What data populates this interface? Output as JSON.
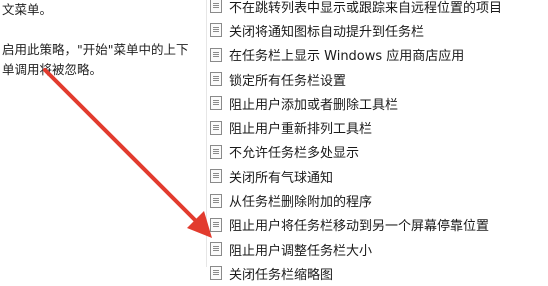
{
  "left_pane": {
    "line1": "文菜单。",
    "line2": "启用此策略，\"开始\"菜单中的上下",
    "line3": "单调用将被忽略。"
  },
  "policy_list": [
    {
      "label": "不在跳转列表中显示或跟踪来自远程位置的项目"
    },
    {
      "label": "关闭将通知图标自动提升到任务栏"
    },
    {
      "label": "在任务栏上显示 Windows 应用商店应用"
    },
    {
      "label": "锁定所有任务栏设置"
    },
    {
      "label": "阻止用户添加或者删除工具栏"
    },
    {
      "label": "阻止用户重新排列工具栏"
    },
    {
      "label": "不允许任务栏多处显示"
    },
    {
      "label": "关闭所有气球通知"
    },
    {
      "label": "从任务栏删除附加的程序"
    },
    {
      "label": "阻止用户将任务栏移动到另一个屏幕停靠位置"
    },
    {
      "label": "阻止用户调整任务栏大小"
    },
    {
      "label": "关闭任务栏缩略图"
    }
  ],
  "annotation": {
    "color": "#e23b2e"
  }
}
